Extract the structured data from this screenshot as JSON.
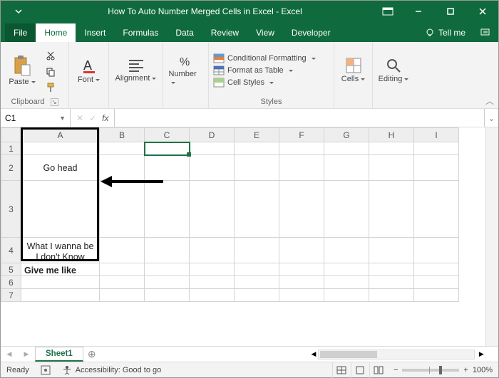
{
  "titlebar": {
    "title": "How To Auto Number Merged Cells in Excel  -  Excel"
  },
  "tabs": {
    "file": "File",
    "items": [
      "Home",
      "Insert",
      "Formulas",
      "Data",
      "Review",
      "View",
      "Developer"
    ],
    "active_index": 0,
    "tellme": "Tell me"
  },
  "ribbon": {
    "clipboard": {
      "paste": "Paste",
      "label": "Clipboard"
    },
    "font": {
      "btn": "Font"
    },
    "alignment": {
      "btn": "Alignment"
    },
    "number": {
      "btn": "Number"
    },
    "styles": {
      "cond": "Conditional Formatting",
      "table": "Format as Table",
      "cellstyles": "Cell Styles",
      "label": "Styles"
    },
    "cells": {
      "btn": "Cells"
    },
    "editing": {
      "btn": "Editing"
    }
  },
  "namebox": {
    "value": "C1"
  },
  "formula": {
    "value": ""
  },
  "grid": {
    "columns": [
      "A",
      "B",
      "C",
      "D",
      "E",
      "F",
      "G",
      "H",
      "I"
    ],
    "rows_visible": [
      1,
      2,
      3,
      4,
      5,
      6,
      7
    ],
    "selected_cell": "C1",
    "col_widths": {
      "A": 110
    },
    "row_heights": {
      "1": 18,
      "2": 36,
      "3": 80,
      "4": 36,
      "5": 18,
      "6": 18,
      "7": 18
    },
    "cells": {
      "A2": "Go head",
      "A4_top": "What I wanna be",
      "A4_bottom": "I don't Know",
      "A5": "Give me like"
    },
    "black_box": {
      "top_row": 1,
      "bottom_row": 5,
      "col": "A"
    }
  },
  "sheettabs": {
    "active": "Sheet1"
  },
  "statusbar": {
    "mode": "Ready",
    "accessibility": "Accessibility: Good to go",
    "zoom": "100%"
  }
}
